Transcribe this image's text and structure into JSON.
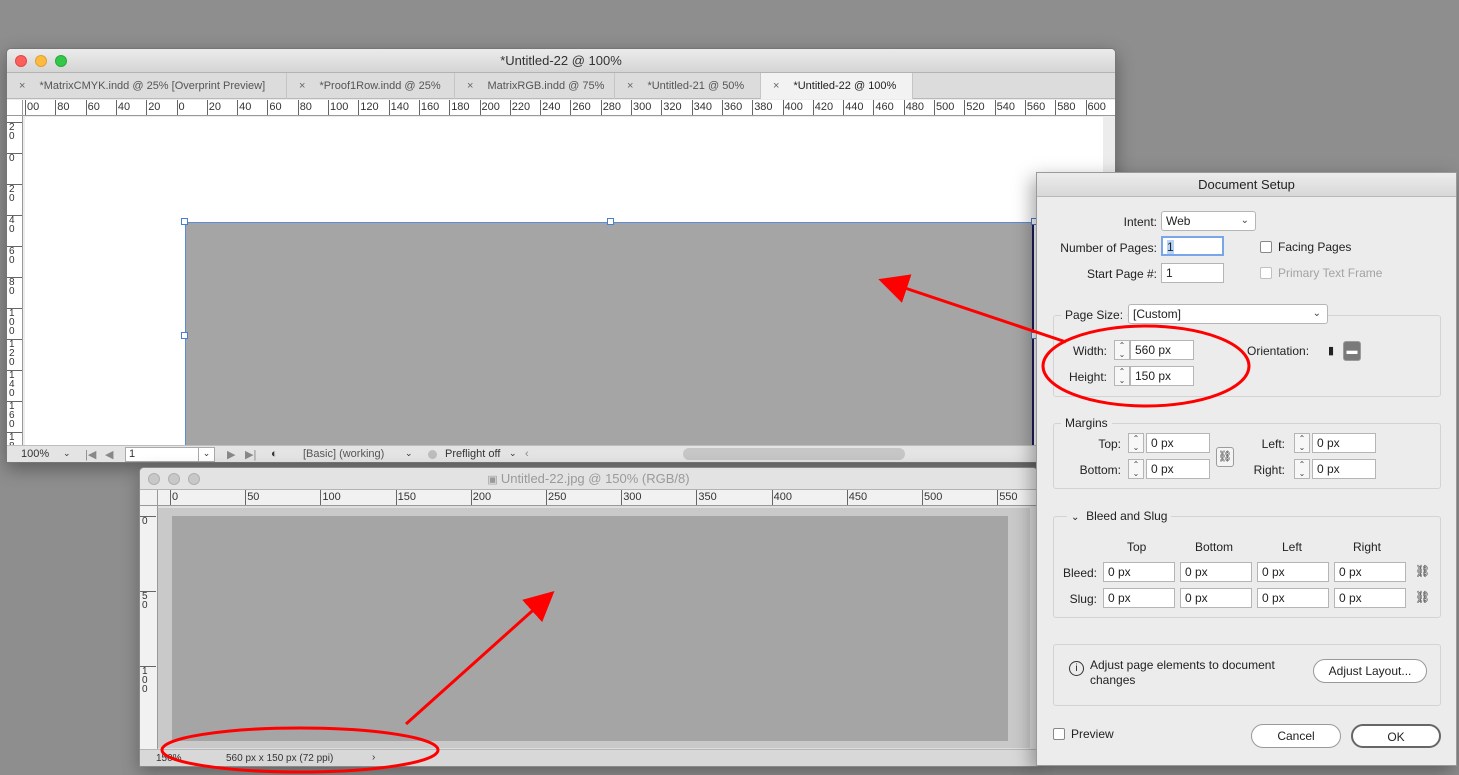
{
  "indesign": {
    "title": "*Untitled-22 @ 100%",
    "tabs": [
      {
        "label": "*MatrixCMYK.indd @ 25% [Overprint Preview]",
        "active": false
      },
      {
        "label": "*Proof1Row.indd @ 25%",
        "active": false
      },
      {
        "label": "MatrixRGB.indd @ 75%",
        "active": false
      },
      {
        "label": "*Untitled-21 @ 50%",
        "active": false
      },
      {
        "label": "*Untitled-22 @ 100%",
        "active": true
      }
    ],
    "hruler_ticks": [
      "00",
      "80",
      "60",
      "40",
      "20",
      "0",
      "20",
      "40",
      "60",
      "80",
      "100",
      "120",
      "140",
      "160",
      "180",
      "200",
      "220",
      "240",
      "260",
      "280",
      "300",
      "320",
      "340",
      "360",
      "380",
      "400",
      "420",
      "440",
      "460",
      "480",
      "500",
      "520",
      "540",
      "560",
      "580",
      "600"
    ],
    "vruler_ticks": [
      "2 0",
      "0",
      "2 0",
      "4 0",
      "6 0",
      "8 0",
      "1 0 0",
      "1 2 0",
      "1 4 0",
      "1 6 0",
      "1 8"
    ],
    "status": {
      "zoom": "100%",
      "page": "1",
      "profile": "[Basic] (working)",
      "preflight": "Preflight off"
    }
  },
  "photoshop": {
    "title": "Untitled-22.jpg @ 150% (RGB/8)",
    "hruler_ticks": [
      "0",
      "50",
      "100",
      "150",
      "200",
      "250",
      "300",
      "350",
      "400",
      "450",
      "500",
      "550"
    ],
    "vruler_ticks": [
      "0",
      "5 0",
      "1 0 0"
    ],
    "status": {
      "zoom": "150%",
      "doc_info": "560 px x 150 px (72 ppi)"
    }
  },
  "dialog": {
    "title": "Document Setup",
    "intent_label": "Intent:",
    "intent_value": "Web",
    "pages_label": "Number of Pages:",
    "pages_value": "1",
    "start_label": "Start Page #:",
    "start_value": "1",
    "facing_pages": "Facing Pages",
    "primary_frame": "Primary Text Frame",
    "page_size_label": "Page Size:",
    "page_size_value": "[Custom]",
    "width_label": "Width:",
    "width_value": "560 px",
    "height_label": "Height:",
    "height_value": "150 px",
    "orientation_label": "Orientation:",
    "margins": {
      "heading": "Margins",
      "top_label": "Top:",
      "top": "0 px",
      "bottom_label": "Bottom:",
      "bottom": "0 px",
      "left_label": "Left:",
      "left": "0 px",
      "right_label": "Right:",
      "right": "0 px"
    },
    "bleed": {
      "heading": "Bleed and Slug",
      "col_top": "Top",
      "col_bottom": "Bottom",
      "col_left": "Left",
      "col_right": "Right",
      "bleed_label": "Bleed:",
      "slug_label": "Slug:",
      "bleed_values": [
        "0 px",
        "0 px",
        "0 px",
        "0 px"
      ],
      "slug_values": [
        "0 px",
        "0 px",
        "0 px",
        "0 px"
      ]
    },
    "adjust_text": "Adjust page elements to document changes",
    "adjust_button": "Adjust Layout...",
    "preview": "Preview",
    "cancel": "Cancel",
    "ok": "OK"
  },
  "colors": {
    "annotation": "#ff0000",
    "page": "#a5a5a5",
    "selection": "#4a7fd0"
  }
}
